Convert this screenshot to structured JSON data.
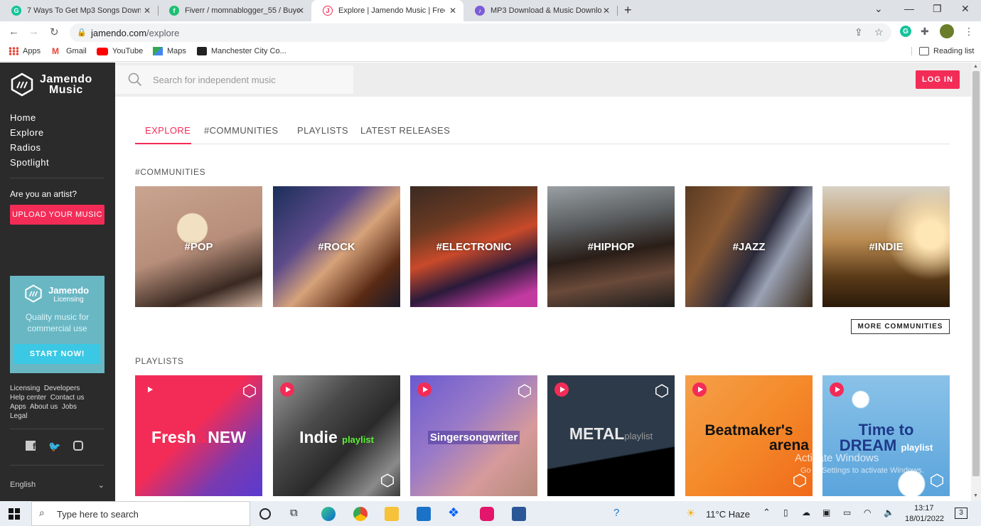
{
  "browser": {
    "tabs": [
      {
        "title": "7 Ways To Get Mp3 Songs Downl",
        "favicon_color": "#15c39a"
      },
      {
        "title": "Fiverr / momnablogger_55 / Buye",
        "favicon_color": "#1dbf73"
      },
      {
        "title": "Explore | Jamendo Music | Free m",
        "favicon_color": "#f32c57"
      },
      {
        "title": "MP3 Download & Music Downlo",
        "favicon_color": "#7b5cd6"
      }
    ],
    "url_host": "jamendo.com",
    "url_path": "/explore",
    "bookmarks": [
      "Apps",
      "Gmail",
      "YouTube",
      "Maps",
      "Manchester City Co..."
    ],
    "reading_list": "Reading list"
  },
  "sidebar": {
    "logo_line1": "Jamendo",
    "logo_line2": "Music",
    "nav": [
      "Home",
      "Explore",
      "Radios",
      "Spotlight"
    ],
    "artist_prompt": "Are you an artist?",
    "upload_label": "UPLOAD YOUR MUSIC",
    "licensing": {
      "name": "Jamendo",
      "sub": "Licensing",
      "tagline1": "Quality music for",
      "tagline2": "commercial use",
      "cta": "START NOW!"
    },
    "footer_links": [
      "Licensing",
      "Developers",
      "Help center",
      "Contact us",
      "Apps",
      "About us",
      "Jobs",
      "Legal"
    ],
    "language": "English"
  },
  "header": {
    "search_placeholder": "Search for independent music",
    "login_label": "LOG IN"
  },
  "main": {
    "tabs": [
      "EXPLORE",
      "#COMMUNITIES",
      "PLAYLISTS",
      "LATEST RELEASES"
    ],
    "communities_heading": "#COMMUNITIES",
    "communities": [
      "#POP",
      "#ROCK",
      "#ELECTRONIC",
      "#HIPHOP",
      "#JAZZ",
      "#INDIE"
    ],
    "more_communities": "MORE COMMUNITIES",
    "playlists_heading": "PLAYLISTS",
    "playlists": [
      {
        "title": "Fresh",
        "title2": "NEW"
      },
      {
        "title": "Indie",
        "title2": "playlist"
      },
      {
        "title": "Singersongwriter",
        "title2": ""
      },
      {
        "title": "METAL",
        "title2": "playlist"
      },
      {
        "title": "Beatmaker's",
        "title2": "arena"
      },
      {
        "title": "Time to",
        "title2": "DREAM",
        "title3": "playlist"
      }
    ]
  },
  "watermark": {
    "line1": "Activate Windows",
    "line2": "Go to Settings to activate Windows."
  },
  "taskbar": {
    "search_placeholder": "Type here to search",
    "weather": "11°C  Haze",
    "time": "13:17",
    "date": "18/01/2022",
    "notifications": "3"
  },
  "colors": {
    "accent": "#f32c57",
    "sidebar": "#2b2b2b",
    "licensing": "#6ab7c4"
  }
}
